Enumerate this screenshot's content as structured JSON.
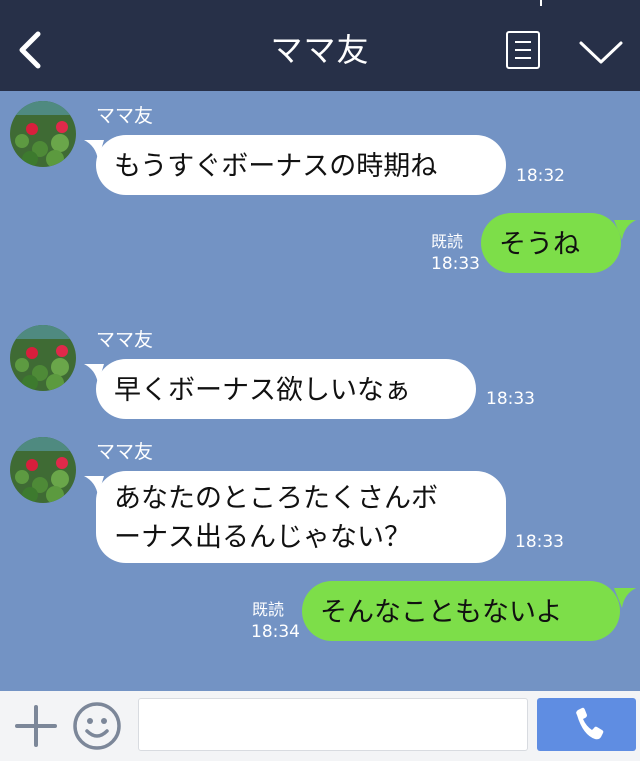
{
  "header": {
    "title": "ママ友"
  },
  "messages": [
    {
      "direction": "in",
      "sender": "ママ友",
      "text": "もうすぐボーナスの時期ね",
      "time": "18:32"
    },
    {
      "direction": "out",
      "text": "そうね",
      "read": "既読",
      "time": "18:33"
    },
    {
      "direction": "in",
      "sender": "ママ友",
      "text": "早くボーナス欲しいなぁ",
      "time": "18:33"
    },
    {
      "direction": "in",
      "sender": "ママ友",
      "text": "あなたのところたくさんボ\nーナス出るんじゃない？",
      "time": "18:33"
    },
    {
      "direction": "out",
      "text": "そんなこともないよ",
      "read": "既読",
      "time": "18:34"
    }
  ],
  "colors": {
    "header_bg": "#273048",
    "chat_bg": "#7393c4",
    "outgoing_bubble": "#7dde49",
    "incoming_bubble": "#ffffff",
    "call_button": "#5f8de2"
  },
  "icons": {
    "back": "chevron-left-icon",
    "menu": "menu-icon",
    "collapse": "chevron-down-icon",
    "add": "plus-icon",
    "emoji": "smile-icon",
    "call": "phone-icon"
  }
}
